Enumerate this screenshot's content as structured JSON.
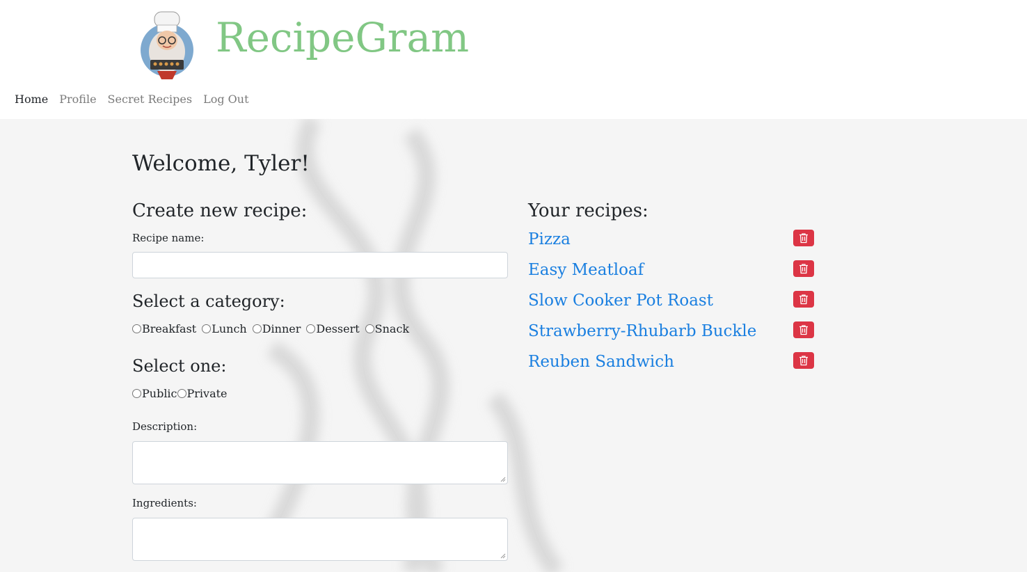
{
  "brand": {
    "name": "RecipeGram"
  },
  "nav": [
    "Home",
    "Profile",
    "Secret Recipes",
    "Log Out"
  ],
  "main": {
    "welcome": "Welcome, Tyler!",
    "create": {
      "heading": "Create new recipe:",
      "recipe_name_label": "Recipe name:",
      "recipe_name_value": "",
      "category_heading": "Select a category:",
      "categories": [
        "Breakfast",
        "Lunch",
        "Dinner",
        "Dessert",
        "Snack"
      ],
      "visibility_heading": "Select one:",
      "visibility_options": [
        "Public",
        "Private"
      ],
      "description_label": "Description:",
      "ingredients_label": "Ingredients:"
    },
    "your_recipes": {
      "heading": "Your recipes:",
      "items": [
        "Pizza",
        "Easy Meatloaf",
        "Slow Cooker Pot Roast",
        "Strawberry-Rhubarb Buckle",
        "Reuben Sandwich"
      ]
    }
  },
  "colors": {
    "brand": "#81c784",
    "link": "#1a7fe0",
    "danger": "#dc3545",
    "background": "#f5f5f5"
  },
  "icons": {
    "logo": "chef-grandma-logo",
    "delete": "trash-icon"
  }
}
